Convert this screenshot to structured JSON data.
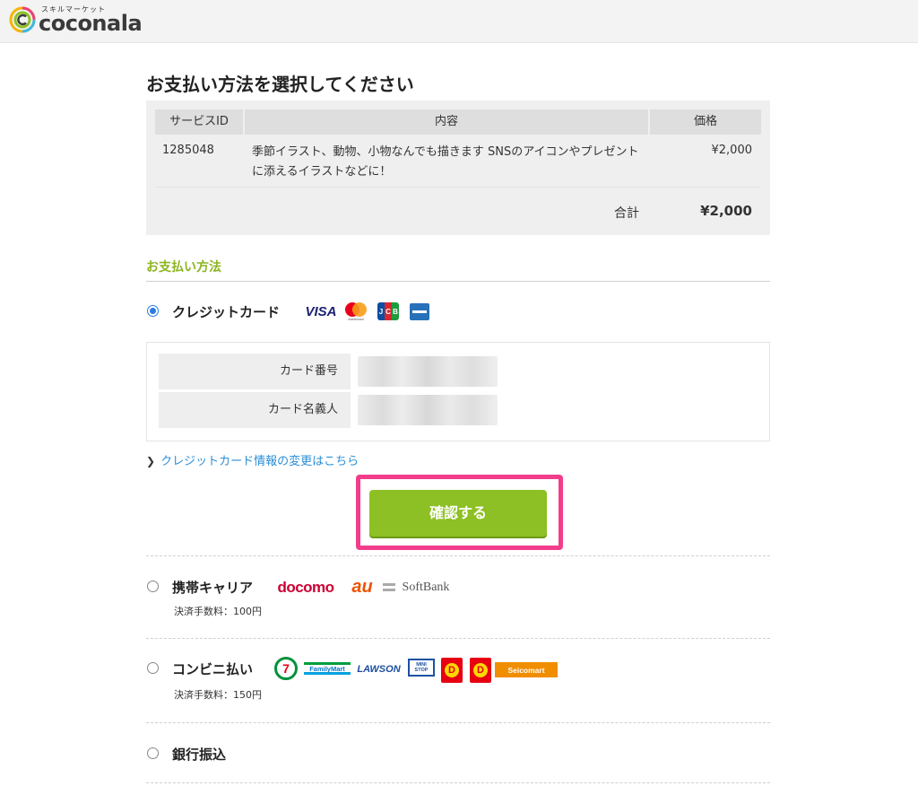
{
  "brand": {
    "subtitle": "スキルマーケット",
    "name": "coconala"
  },
  "page_title": "お支払い方法を選択してください",
  "order": {
    "headers": {
      "id": "サービスID",
      "desc": "内容",
      "price": "価格"
    },
    "items": [
      {
        "id": "1285048",
        "desc": "季節イラスト、動物、小物なんでも描きます SNSのアイコンやプレゼントに添えるイラストなどに！",
        "price": "¥2,000"
      }
    ],
    "total_label": "合計",
    "total_value": "¥2,000"
  },
  "payment": {
    "section_title": "お支払い方法",
    "credit": {
      "label": "クレジットカード",
      "brands": {
        "visa": "VISA",
        "jcb": "JCB"
      },
      "card_number_label": "カード番号",
      "card_holder_label": "カード名義人",
      "change_link": "クレジットカード情報の変更はこちら",
      "confirm_button": "確認する"
    },
    "carrier": {
      "label": "携帯キャリア",
      "fee": "決済手数料：100円",
      "logos": {
        "docomo": "docomo",
        "au": "au",
        "softbank": "SoftBank"
      }
    },
    "convenience": {
      "label": "コンビニ払い",
      "fee": "決済手数料：150円",
      "logos": {
        "seven": "7",
        "familymart": "FamilyMart",
        "lawson": "LAWSON",
        "ministop": "MINI STOP",
        "daily1": "D",
        "daily2": "D",
        "seicomart": "Seicomart"
      }
    },
    "bank": {
      "label": "銀行振込"
    }
  },
  "colors": {
    "accent_green": "#8dc024",
    "section_green": "#8cb420",
    "link_blue": "#2b8ed6",
    "highlight_pink": "#f23d8a",
    "radio_blue": "#2a7be4"
  }
}
